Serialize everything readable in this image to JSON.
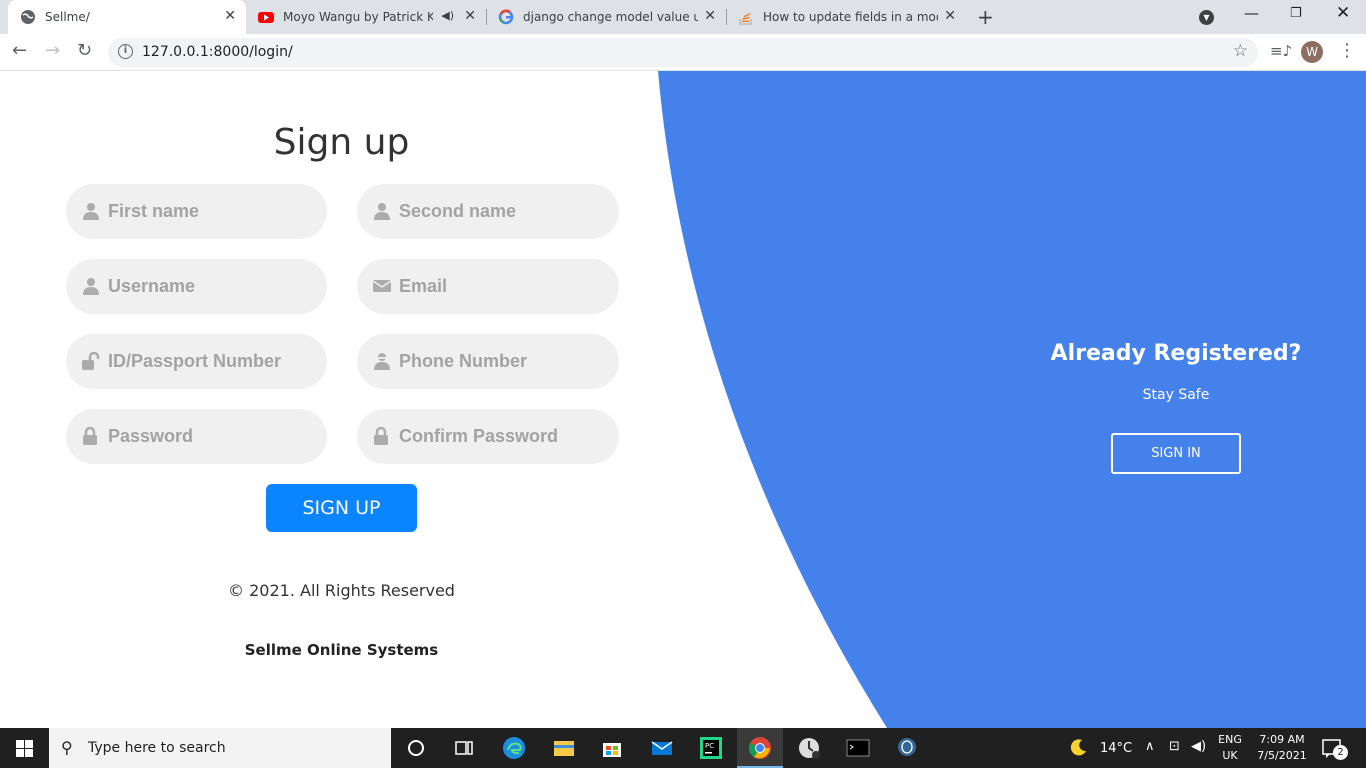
{
  "browser": {
    "tabs": [
      {
        "title": "Sellme/",
        "active": true,
        "icon": "globe-icon"
      },
      {
        "title": "Moyo Wangu by Patrick Kubu",
        "active": false,
        "icon": "youtube-icon"
      },
      {
        "title": "django change model value using",
        "active": false,
        "icon": "google-icon"
      },
      {
        "title": "How to update fields in a model",
        "active": false,
        "icon": "stackoverflow-icon"
      }
    ],
    "url": "127.0.0.1:8000/login/",
    "profile_initial": "W"
  },
  "signup": {
    "title": "Sign up",
    "fields": {
      "first_name": "First name",
      "second_name": "Second name",
      "username": "Username",
      "email": "Email",
      "id_number": "ID/Passport Number",
      "phone": "Phone Number",
      "password": "Password",
      "confirm_password": "Confirm Password"
    },
    "button": "SIGN UP",
    "copyright": "© 2021. All Rights Reserved",
    "company": "Sellme Online Systems"
  },
  "side_panel": {
    "title": "Already Registered?",
    "subtitle": "Stay Safe",
    "button": "SIGN IN",
    "color": "#4481eb"
  },
  "taskbar": {
    "search_placeholder": "Type here to search",
    "weather": "14°C",
    "lang_top": "ENG",
    "lang_bottom": "UK",
    "time": "7:09 AM",
    "date": "7/5/2021",
    "notification_count": "2"
  }
}
